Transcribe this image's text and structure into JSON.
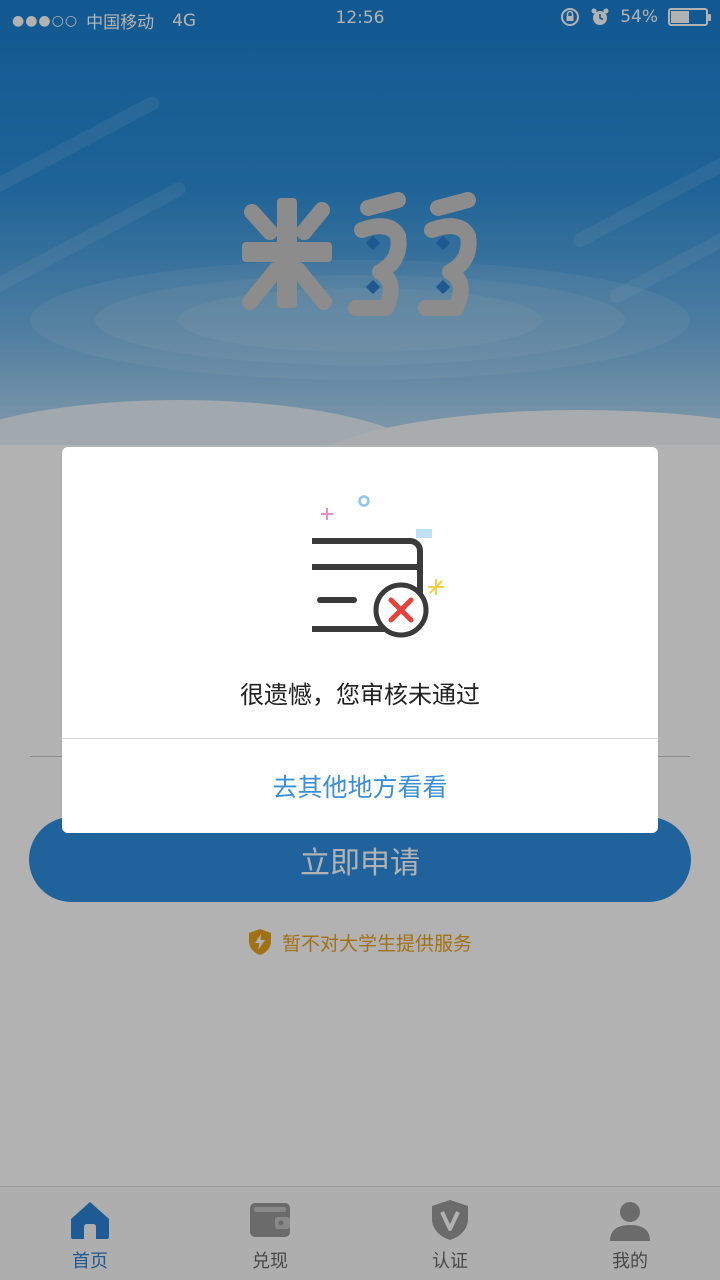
{
  "status_bar": {
    "signal_dots": "●●●○○",
    "carrier": "中国移动",
    "network": "4G",
    "time": "12:56",
    "battery_percent": "54%",
    "battery_level": 0.54,
    "icons": [
      "orientation-lock-icon",
      "alarm-icon",
      "battery-icon"
    ]
  },
  "brand": {
    "logo_icon": "app-logo-icon"
  },
  "main": {
    "apply_button_label": "立即申请",
    "notice_text": "暂不对大学生提供服务",
    "notice_icon": "shield-bolt-icon"
  },
  "dialog": {
    "message": "很遗憾，您审核未通过",
    "action_label": "去其他地方看看",
    "illustration_icon": "card-rejected-icon"
  },
  "tabs": [
    {
      "label": "首页",
      "icon": "home-icon",
      "active": true
    },
    {
      "label": "兑现",
      "icon": "wallet-icon",
      "active": false
    },
    {
      "label": "认证",
      "icon": "shield-v-icon",
      "active": false
    },
    {
      "label": "我的",
      "icon": "user-icon",
      "active": false
    }
  ],
  "colors": {
    "primary": "#2e8ee0",
    "tab_active": "#2b83d6",
    "notice": "#e7a220",
    "dialog_action": "#3b8fd6",
    "error_red": "#e8413c"
  }
}
